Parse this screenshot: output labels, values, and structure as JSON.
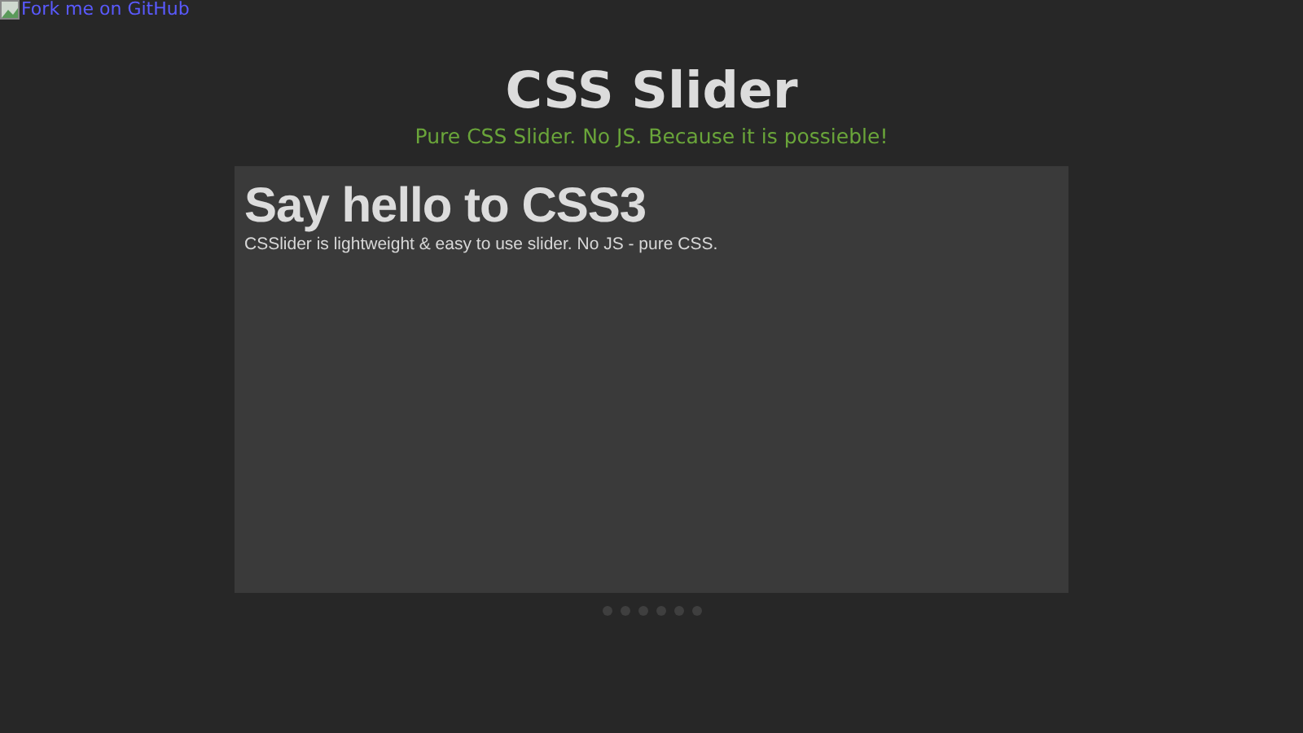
{
  "corner_link": {
    "text": "Fork me on GitHub"
  },
  "header": {
    "title": "CSS Slider",
    "subtitle": "Pure CSS Slider. No JS. Because it is possieble!"
  },
  "slide": {
    "heading": "Say hello to CSS3",
    "text": "CSSlider is lightweight & easy to use slider. No JS - pure CSS."
  },
  "dots": [
    {
      "selected": false
    },
    {
      "selected": false
    },
    {
      "selected": false
    },
    {
      "selected": false
    },
    {
      "selected": false
    },
    {
      "selected": false
    }
  ]
}
